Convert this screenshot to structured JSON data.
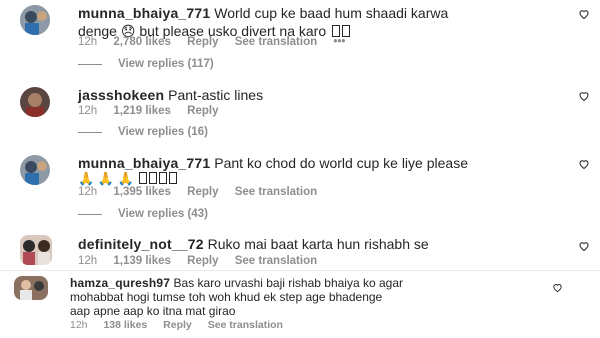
{
  "comments": [
    {
      "username": "munna_bhaiya_771",
      "text_line1": "World cup ke baad hum shaadi karwa",
      "text_line2a": "denge",
      "text_line2b": "but please usko divert na karo",
      "time": "12h",
      "likes": "2,780 likes",
      "reply": "Reply",
      "see_translation": "See translation",
      "more": "•••",
      "view_replies": "View replies (117)"
    },
    {
      "username": "jassshokeen",
      "text": "Pant-astic lines",
      "time": "12h",
      "likes": "1,219 likes",
      "reply": "Reply",
      "view_replies": "View replies (16)"
    },
    {
      "username": "munna_bhaiya_771",
      "text_line1": "Pant ko chod do world cup ke liye please",
      "time": "12h",
      "likes": "1,395 likes",
      "reply": "Reply",
      "see_translation": "See translation",
      "view_replies": "View replies (43)"
    },
    {
      "username": "definitely_not__72",
      "text": "Ruko mai baat karta hun rishabh se",
      "time": "12h",
      "likes": "1,139 likes",
      "reply": "Reply",
      "see_translation": "See translation"
    },
    {
      "username": "hamza_quresh97",
      "text_line1": "Bas karo urvashi baji rishab bhaiya ko agar",
      "text_line2": "mohabbat hogi tumse toh woh khud ek step age bhadenge",
      "text_line3": "aap apne aap ko itna mat girao",
      "time": "12h",
      "likes": "138 likes",
      "reply": "Reply",
      "see_translation": "See translation"
    }
  ],
  "icons": {
    "heart": "heart-outline-icon",
    "pray": "🙏",
    "sad": "😞"
  },
  "colors": {
    "text": "#262626",
    "meta": "#8e8e8e"
  }
}
